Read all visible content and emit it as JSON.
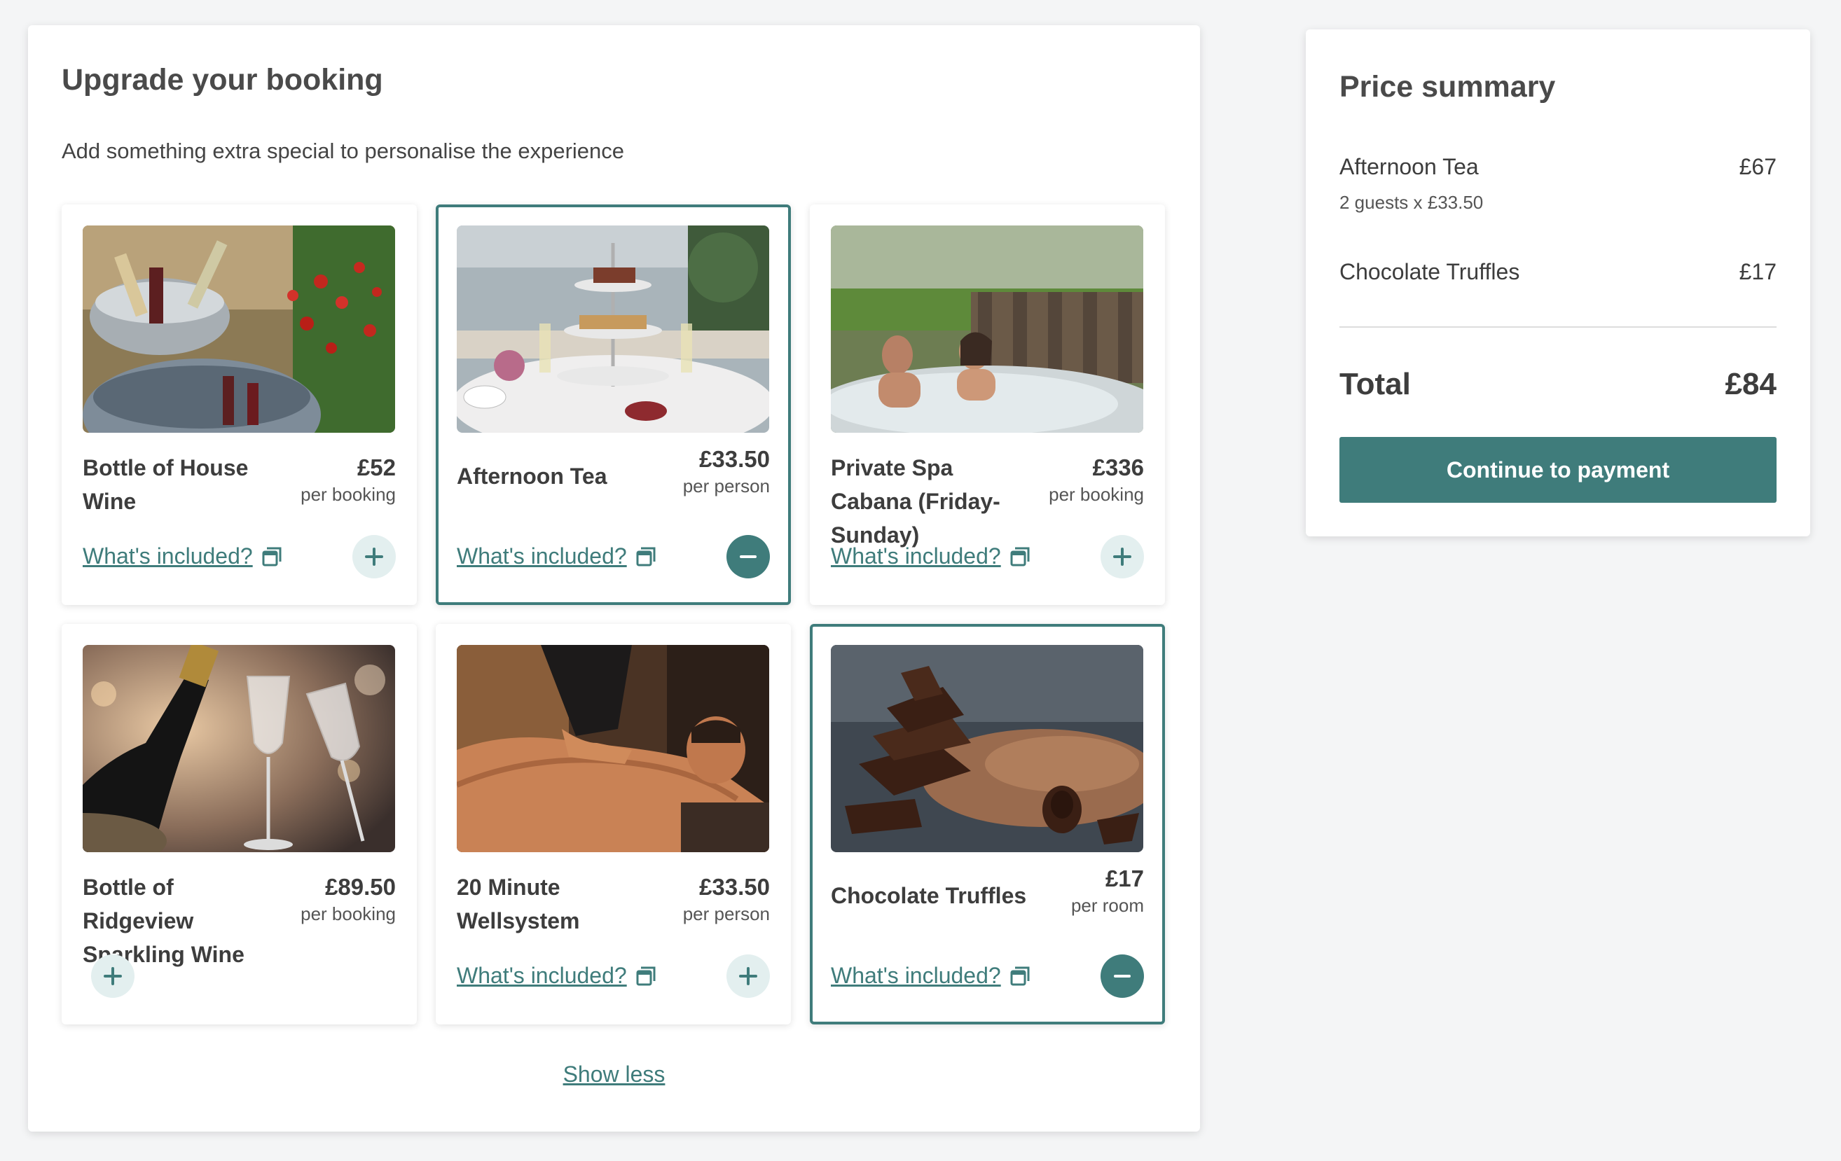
{
  "upgrade": {
    "title": "Upgrade your booking",
    "subtitle": "Add something extra special to personalise the experience",
    "show_less": "Show less",
    "included_label": "What's included?",
    "items": [
      {
        "name": "Bottle of House Wine",
        "price": "£52",
        "unit": "per booking",
        "selected": false,
        "image": "wine-buckets-image"
      },
      {
        "name": "Afternoon Tea",
        "price": "£33.50",
        "unit": "per person",
        "selected": true,
        "image": "afternoon-tea-image"
      },
      {
        "name": "Private Spa Cabana (Friday-Sunday)",
        "price": "£336",
        "unit": "per booking",
        "selected": false,
        "image": "hot-tub-couple-image"
      },
      {
        "name": "Bottle of Ridgeview Sparkling Wine",
        "price": "£89.50",
        "unit": "per booking",
        "selected": false,
        "image": "sparkling-wine-glasses-image"
      },
      {
        "name": "20 Minute Wellsystem",
        "price": "£33.50",
        "unit": "per person",
        "selected": false,
        "image": "massage-image"
      },
      {
        "name": "Chocolate Truffles",
        "price": "£17",
        "unit": "per room",
        "selected": true,
        "image": "chocolate-image"
      }
    ]
  },
  "summary": {
    "title": "Price summary",
    "lines": [
      {
        "name": "Afternoon Tea",
        "amount": "£67",
        "detail": "2 guests x £33.50"
      },
      {
        "name": "Chocolate Truffles",
        "amount": "£17"
      }
    ],
    "total_label": "Total",
    "total_amount": "£84",
    "cta": "Continue to payment"
  },
  "colors": {
    "accent": "#3f7c7b",
    "accent_light": "#e3efef"
  }
}
